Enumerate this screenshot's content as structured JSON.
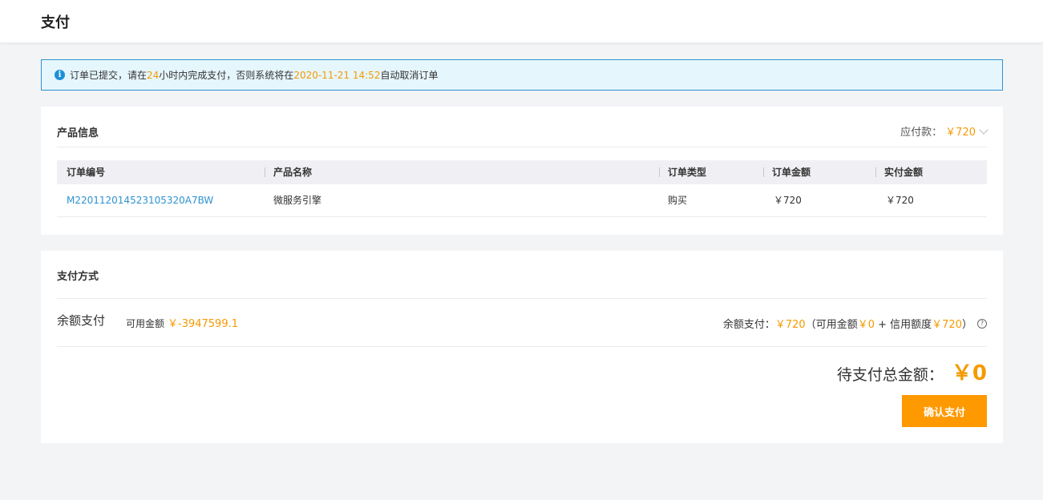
{
  "header": {
    "title": "支付"
  },
  "notice": {
    "icon": "info-icon",
    "text_1": "订单已提交，请在 ",
    "hours": "24",
    "text_2": " 小时内完成支付，否则系统将在 ",
    "deadline": "2020-11-21 14:52",
    "text_3": " 自动取消订单"
  },
  "product": {
    "title": "产品信息",
    "due_label": "应付款：",
    "due_amount": "￥720",
    "columns": [
      "订单编号",
      "产品名称",
      "订单类型",
      "订单金额",
      "实付金额"
    ],
    "rows": [
      {
        "order_no": "M220112014523105320A7BW",
        "product_name": "微服务引擎",
        "order_type": "购买",
        "order_amount": "￥720",
        "paid_amount": "￥720"
      }
    ]
  },
  "payment": {
    "title": "支付方式",
    "balance_label": "余额支付",
    "available_label": "可用金额",
    "available_value": "￥-3947599.1",
    "summary": {
      "label": "余额支付：",
      "amount": "￥720",
      "open": "（可用金额",
      "available": "￥0",
      "plus": " + 信用额度",
      "credit": "￥720",
      "close": "）"
    },
    "total_label": "待支付总金额：",
    "total_value": "￥0",
    "confirm_label": "确认支付"
  },
  "colors": {
    "accent": "#f59a00",
    "link": "#2d93d0",
    "notice_border": "#2d93d0",
    "notice_bg": "#e6f6fd",
    "button": "#ff9900"
  }
}
